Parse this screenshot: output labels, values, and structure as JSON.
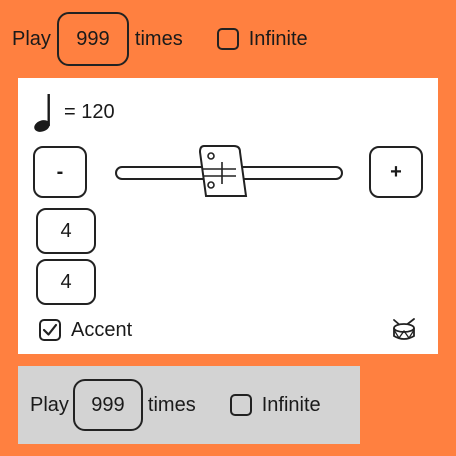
{
  "top_row": {
    "play_label": "Play",
    "count": "999",
    "times_label": "times",
    "infinite_label": "Infinite",
    "infinite_checked": false
  },
  "metronome": {
    "tempo_text": "= 120",
    "tempo_value": 120,
    "minus_label": "-",
    "plus_label": "+",
    "beats_per_measure": "4",
    "beat_unit": "4",
    "accent_label": "Accent",
    "accent_checked": true,
    "icons": [
      "quarter-note-icon",
      "metronome-icon",
      "drum-icon"
    ]
  },
  "bottom_row": {
    "play_label": "Play",
    "count": "999",
    "times_label": "times",
    "infinite_label": "Infinite",
    "infinite_checked": false
  },
  "colors": {
    "background": "#ff8040",
    "panel": "#ffffff",
    "disabled_panel": "#d3d3d3"
  }
}
